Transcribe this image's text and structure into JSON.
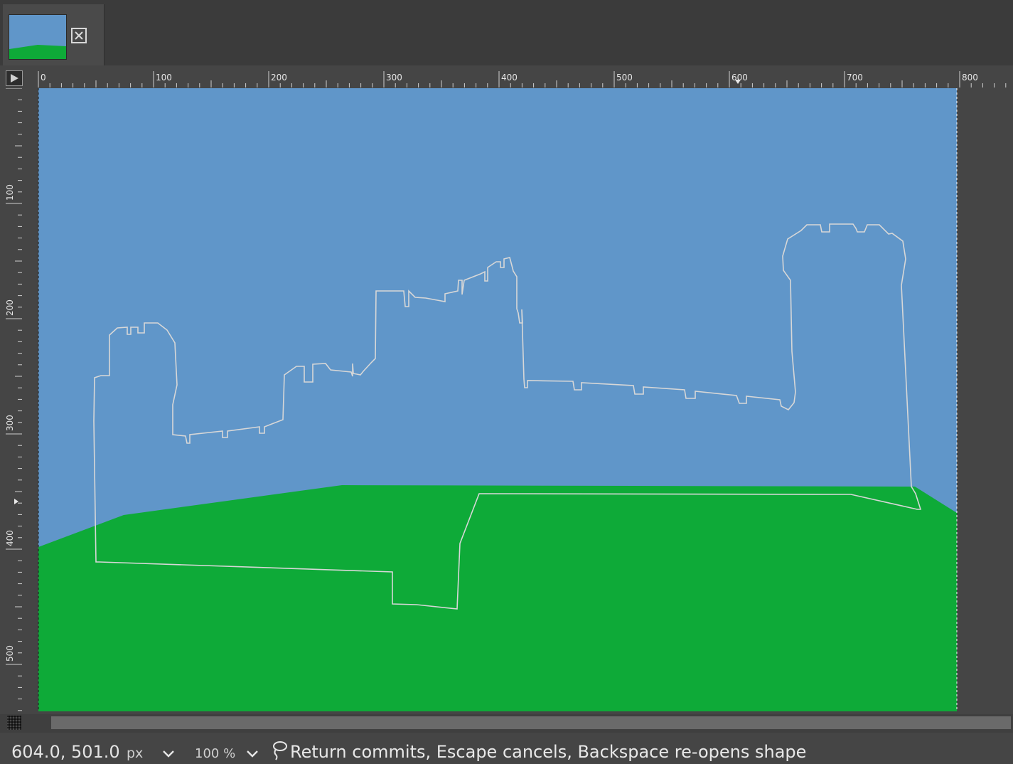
{
  "image_tab": {
    "thumbnail_icon": "image-thumbnail",
    "close_icon": "close-box-icon"
  },
  "rulers": {
    "horizontal_labels": [
      "0",
      "100",
      "200",
      "300",
      "400",
      "500",
      "600",
      "700",
      "800"
    ],
    "vertical_labels": [
      "100",
      "200",
      "300",
      "400",
      "500"
    ]
  },
  "canvas": {
    "sky_color": "#6096c9",
    "grass_color": "#0eaa38",
    "selection_outline_color": "#d7d7d7"
  },
  "statusbar": {
    "pointer_coords": "604.0, 501.0",
    "unit": "px",
    "zoom": "100 %",
    "message": "Return commits, Escape cancels, Backspace re-opens shape"
  }
}
